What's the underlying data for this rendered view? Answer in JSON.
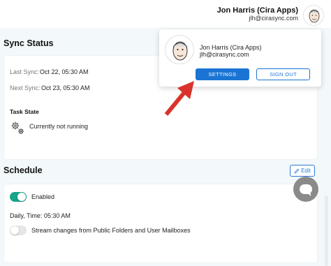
{
  "header": {
    "user_name": "Jon Harris (Cira Apps)",
    "user_email": "jlh@cirasync.com",
    "avatar_icon": "user-cartoon-avatar"
  },
  "sync_status": {
    "title": "Sync Status",
    "last_sync_label": "Last Sync:",
    "last_sync_value": "Oct 22, 05:30 AM",
    "next_sync_label": "Next Sync:",
    "next_sync_value": "Oct 23, 05:30 AM",
    "task_state_label": "Task State",
    "task_state_value": "Currently not running",
    "task_state_icon": "gears-icon"
  },
  "schedule": {
    "title": "Schedule",
    "edit_label": "Edit",
    "enabled_label": "Enabled",
    "enabled": true,
    "daily_time": "Daily, Time: 05:30 AM",
    "stream_label": "Stream changes from Public Folders and User Mailboxes",
    "stream_enabled": false
  },
  "profile_popup": {
    "name": "Jon Harris (Cira Apps)",
    "email": "jlh@cirasync.com",
    "settings_label": "SETTINGS",
    "signout_label": "SIGN OUT"
  },
  "colors": {
    "primary": "#1b74d4",
    "toggle_on": "#17a589",
    "arrow": "#d9332b",
    "chat": "#8a8a8a"
  }
}
